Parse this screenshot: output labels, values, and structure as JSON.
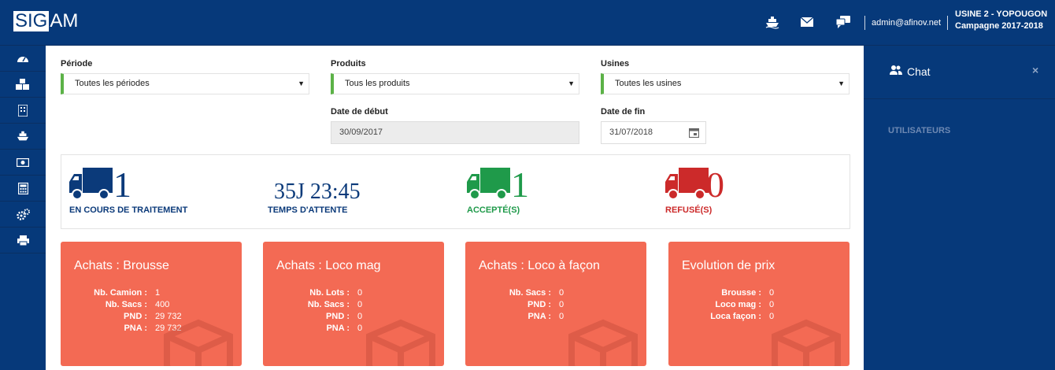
{
  "app": {
    "logo_box": "SIG",
    "logo_rest": "AM"
  },
  "topbar": {
    "user_email": "admin@afinov.net",
    "usine": "USINE 2 - YOPOUGON",
    "campagne": "Campagne 2017-2018"
  },
  "filters": {
    "periode": {
      "label": "Période",
      "value": "Toutes les périodes"
    },
    "produits": {
      "label": "Produits",
      "value": "Tous les produits"
    },
    "usines": {
      "label": "Usines",
      "value": "Toutes les usines"
    },
    "date_debut": {
      "label": "Date de début",
      "value": "30/09/2017"
    },
    "date_fin": {
      "label": "Date de fin",
      "value": "31/07/2018"
    }
  },
  "stats": {
    "en_cours": {
      "value": "1",
      "label": "EN COURS DE TRAITEMENT",
      "color": "#0b3a7a"
    },
    "attente": {
      "value": "35J 23:45",
      "label": "TEMPS D'ATTENTE",
      "color": "#0b3a7a"
    },
    "accepte": {
      "value": "1",
      "label": "ACCEPTÉ(S)",
      "color": "#1f9a4a"
    },
    "refuse": {
      "value": "0",
      "label": "REFUSÉ(S)",
      "color": "#cc2a2a"
    }
  },
  "cards": [
    {
      "title": "Achats : Brousse",
      "rows": [
        {
          "k": "Nb. Camion :",
          "v": "1"
        },
        {
          "k": "Nb. Sacs :",
          "v": "400"
        },
        {
          "k": "PND :",
          "v": "29 732"
        },
        {
          "k": "PNA :",
          "v": "29 732"
        }
      ]
    },
    {
      "title": "Achats : Loco mag",
      "rows": [
        {
          "k": "Nb. Lots :",
          "v": "0"
        },
        {
          "k": "Nb. Sacs :",
          "v": "0"
        },
        {
          "k": "PND :",
          "v": "0"
        },
        {
          "k": "PNA :",
          "v": "0"
        }
      ]
    },
    {
      "title": "Achats : Loco à façon",
      "rows": [
        {
          "k": "Nb. Sacs :",
          "v": "0"
        },
        {
          "k": "PND :",
          "v": "0"
        },
        {
          "k": "PNA :",
          "v": "0"
        }
      ]
    },
    {
      "title": "Evolution de prix",
      "rows": [
        {
          "k": "Brousse :",
          "v": "0"
        },
        {
          "k": "Loco mag :",
          "v": "0"
        },
        {
          "k": "Loca façon :",
          "v": "0"
        }
      ]
    }
  ],
  "chat": {
    "title": "Chat",
    "close": "×",
    "section": "UTILISATEURS"
  },
  "colors": {
    "navy": "#06397a",
    "green_accent": "#5cb247",
    "card": "#f36a54"
  }
}
